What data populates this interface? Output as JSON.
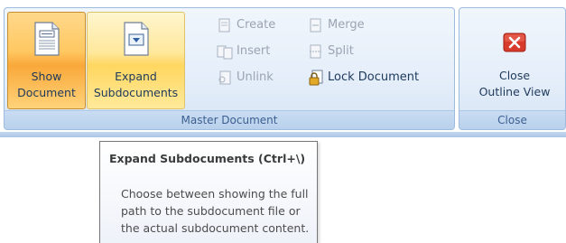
{
  "master_document": {
    "group_label": "Master Document",
    "show_document_label": "Show\nDocument",
    "expand_subdocuments_label": "Expand\nSubdocuments",
    "create_label": "Create",
    "merge_label": "Merge",
    "insert_label": "Insert",
    "split_label": "Split",
    "unlink_label": "Unlink",
    "lock_document_label": "Lock Document"
  },
  "close_group": {
    "group_label": "Close",
    "close_outline_view_label": "Close\nOutline View"
  },
  "tooltip": {
    "title": "Expand Subdocuments (Ctrl+\\)",
    "description": "Choose between showing the full path to the subdocument file or the actual subdocument content."
  },
  "colors": {
    "pressed_button": "#ffc862",
    "hover_button": "#ffe89b",
    "close_icon_red": "#d83b2b",
    "ribbon_text": "#1e395b",
    "disabled_text": "#9aa4b2"
  }
}
